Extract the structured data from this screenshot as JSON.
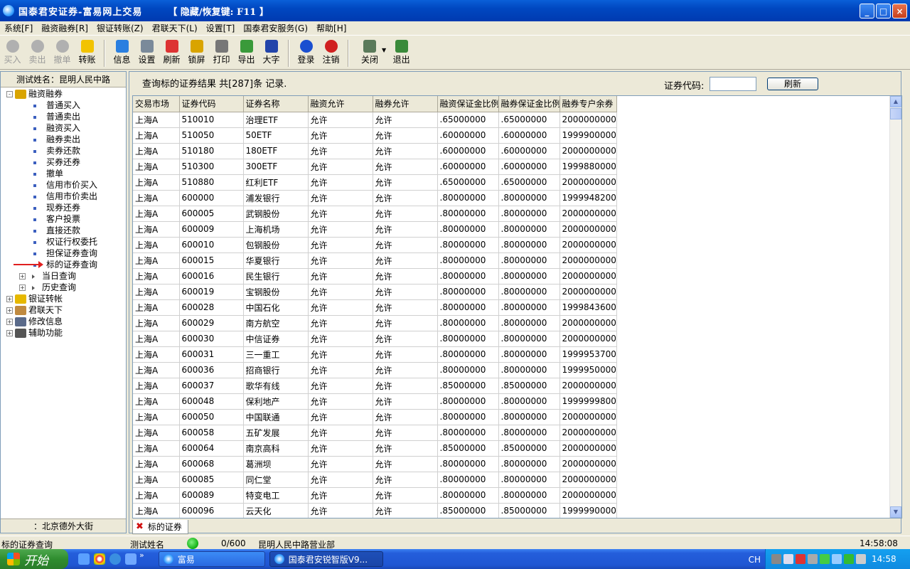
{
  "window": {
    "title": "国泰君安证券-富易网上交易",
    "hint": "【 隐藏/恢复键: F11 】",
    "minimize": "_",
    "maximize": "□",
    "close": "×"
  },
  "menu": [
    "系统[F]",
    "融资融券[R]",
    "银证转账(Z)",
    "君联天下(L)",
    "设置[T]",
    "国泰君安服务(G)",
    "帮助[H]"
  ],
  "toolbar": [
    {
      "label": "买入",
      "icon": "circle-icon",
      "disabled": true
    },
    {
      "label": "卖出",
      "icon": "circle-icon",
      "disabled": true
    },
    {
      "label": "撤单",
      "icon": "cup-icon",
      "disabled": true
    },
    {
      "label": "转账",
      "icon": "dollar-icon",
      "disabled": false
    },
    {
      "label": "信息",
      "icon": "ie-icon",
      "disabled": false
    },
    {
      "label": "设置",
      "icon": "settings-icon",
      "disabled": false
    },
    {
      "label": "刷新",
      "icon": "refresh-icon",
      "disabled": false
    },
    {
      "label": "锁屏",
      "icon": "lock-icon",
      "disabled": false
    },
    {
      "label": "打印",
      "icon": "print-icon",
      "disabled": false
    },
    {
      "label": "导出",
      "icon": "export-icon",
      "disabled": false
    },
    {
      "label": "大字",
      "icon": "font-icon",
      "disabled": false
    },
    {
      "label": "登录",
      "icon": "login-icon",
      "disabled": false
    },
    {
      "label": "注销",
      "icon": "logout-icon",
      "disabled": false
    },
    {
      "label": "关闭",
      "icon": "close-doc-icon",
      "disabled": false
    },
    {
      "label": "退出",
      "icon": "exit-icon",
      "disabled": false
    }
  ],
  "left": {
    "header": "测试姓名：昆明人民中路",
    "footer": "：北京德外大街",
    "tree": [
      {
        "level": 0,
        "kind": "folder",
        "expand": "-",
        "label": "融资融券"
      },
      {
        "level": 1,
        "kind": "leaf",
        "label": "普通买入"
      },
      {
        "level": 1,
        "kind": "leaf",
        "label": "普通卖出"
      },
      {
        "level": 1,
        "kind": "leaf",
        "label": "融资买入"
      },
      {
        "level": 1,
        "kind": "leaf",
        "label": "融券卖出"
      },
      {
        "level": 1,
        "kind": "leaf",
        "label": "卖券还款"
      },
      {
        "level": 1,
        "kind": "leaf",
        "label": "买券还券"
      },
      {
        "level": 1,
        "kind": "leaf",
        "label": "撤单"
      },
      {
        "level": 1,
        "kind": "leaf",
        "label": "信用市价买入"
      },
      {
        "level": 1,
        "kind": "leaf",
        "label": "信用市价卖出"
      },
      {
        "level": 1,
        "kind": "leaf",
        "label": "现券还券"
      },
      {
        "level": 1,
        "kind": "leaf",
        "label": "客户投票"
      },
      {
        "level": 1,
        "kind": "leaf",
        "label": "直接还款"
      },
      {
        "level": 1,
        "kind": "leaf",
        "label": "权证行权委托"
      },
      {
        "level": 1,
        "kind": "leaf",
        "label": "担保证券查询"
      },
      {
        "level": 1,
        "kind": "leaf",
        "label": "标的证券查询",
        "selected": true
      },
      {
        "level": 1,
        "kind": "sub",
        "expand": "+",
        "label": "当日查询"
      },
      {
        "level": 1,
        "kind": "sub",
        "expand": "+",
        "label": "历史查询"
      },
      {
        "level": 0,
        "kind": "folder",
        "expand": "+",
        "label": "银证转帐"
      },
      {
        "level": 0,
        "kind": "folder",
        "expand": "+",
        "label": "君联天下"
      },
      {
        "level": 0,
        "kind": "folder",
        "expand": "+",
        "label": "修改信息"
      },
      {
        "level": 0,
        "kind": "folder",
        "expand": "+",
        "label": "辅助功能"
      }
    ]
  },
  "query": {
    "title": "查询标的证券结果 共[287]条 记录.",
    "code_label": "证券代码:",
    "code_value": "",
    "refresh": "刷新"
  },
  "table": {
    "columns": [
      "交易市场",
      "证券代码",
      "证券名称",
      "融资允许",
      "融券允许",
      "融资保证金比例",
      "融券保证金比例",
      "融券专户余券"
    ],
    "rows": [
      [
        "上海A",
        "510010",
        "治理ETF",
        "允许",
        "允许",
        ".65000000",
        ".65000000",
        "2000000000"
      ],
      [
        "上海A",
        "510050",
        "50ETF",
        "允许",
        "允许",
        ".60000000",
        ".60000000",
        "1999900000"
      ],
      [
        "上海A",
        "510180",
        "180ETF",
        "允许",
        "允许",
        ".60000000",
        ".60000000",
        "2000000000"
      ],
      [
        "上海A",
        "510300",
        "300ETF",
        "允许",
        "允许",
        ".60000000",
        ".60000000",
        "1999880000"
      ],
      [
        "上海A",
        "510880",
        "红利ETF",
        "允许",
        "允许",
        ".65000000",
        ".65000000",
        "2000000000"
      ],
      [
        "上海A",
        "600000",
        "浦发银行",
        "允许",
        "允许",
        ".80000000",
        ".80000000",
        "1999948200"
      ],
      [
        "上海A",
        "600005",
        "武钢股份",
        "允许",
        "允许",
        ".80000000",
        ".80000000",
        "2000000000"
      ],
      [
        "上海A",
        "600009",
        "上海机场",
        "允许",
        "允许",
        ".80000000",
        ".80000000",
        "2000000000"
      ],
      [
        "上海A",
        "600010",
        "包钢股份",
        "允许",
        "允许",
        ".80000000",
        ".80000000",
        "2000000000"
      ],
      [
        "上海A",
        "600015",
        "华夏银行",
        "允许",
        "允许",
        ".80000000",
        ".80000000",
        "2000000000"
      ],
      [
        "上海A",
        "600016",
        "民生银行",
        "允许",
        "允许",
        ".80000000",
        ".80000000",
        "2000000000"
      ],
      [
        "上海A",
        "600019",
        "宝钢股份",
        "允许",
        "允许",
        ".80000000",
        ".80000000",
        "2000000000"
      ],
      [
        "上海A",
        "600028",
        "中国石化",
        "允许",
        "允许",
        ".80000000",
        ".80000000",
        "1999843600"
      ],
      [
        "上海A",
        "600029",
        "南方航空",
        "允许",
        "允许",
        ".80000000",
        ".80000000",
        "2000000000"
      ],
      [
        "上海A",
        "600030",
        "中信证券",
        "允许",
        "允许",
        ".80000000",
        ".80000000",
        "2000000000"
      ],
      [
        "上海A",
        "600031",
        "三一重工",
        "允许",
        "允许",
        ".80000000",
        ".80000000",
        "1999953700"
      ],
      [
        "上海A",
        "600036",
        "招商银行",
        "允许",
        "允许",
        ".80000000",
        ".80000000",
        "1999950000"
      ],
      [
        "上海A",
        "600037",
        "歌华有线",
        "允许",
        "允许",
        ".85000000",
        ".85000000",
        "2000000000"
      ],
      [
        "上海A",
        "600048",
        "保利地产",
        "允许",
        "允许",
        ".80000000",
        ".80000000",
        "1999999800"
      ],
      [
        "上海A",
        "600050",
        "中国联通",
        "允许",
        "允许",
        ".80000000",
        ".80000000",
        "2000000000"
      ],
      [
        "上海A",
        "600058",
        "五矿发展",
        "允许",
        "允许",
        ".80000000",
        ".80000000",
        "2000000000"
      ],
      [
        "上海A",
        "600064",
        "南京高科",
        "允许",
        "允许",
        ".85000000",
        ".85000000",
        "2000000000"
      ],
      [
        "上海A",
        "600068",
        "葛洲坝",
        "允许",
        "允许",
        ".80000000",
        ".80000000",
        "2000000000"
      ],
      [
        "上海A",
        "600085",
        "同仁堂",
        "允许",
        "允许",
        ".80000000",
        ".80000000",
        "2000000000"
      ],
      [
        "上海A",
        "600089",
        "特变电工",
        "允许",
        "允许",
        ".80000000",
        ".80000000",
        "2000000000"
      ],
      [
        "上海A",
        "600096",
        "云天化",
        "允许",
        "允许",
        ".85000000",
        ".85000000",
        "1999990000"
      ]
    ]
  },
  "tab": {
    "close": "✖",
    "label": "标的证券"
  },
  "status": {
    "left": "标的证券查询",
    "user": "测试姓名",
    "count": "0/600",
    "branch": "昆明人民中路营业部",
    "time": "14:58:08"
  },
  "taskbar": {
    "start": "开始",
    "tasks": [
      "富易",
      "国泰君安锐智版V9..."
    ],
    "ime": "CH",
    "clock": "14:58",
    "more": "»"
  },
  "colors": {
    "accent": "#0047c0",
    "selection_arrow": "#e02020",
    "status_ok": "#10b010"
  }
}
